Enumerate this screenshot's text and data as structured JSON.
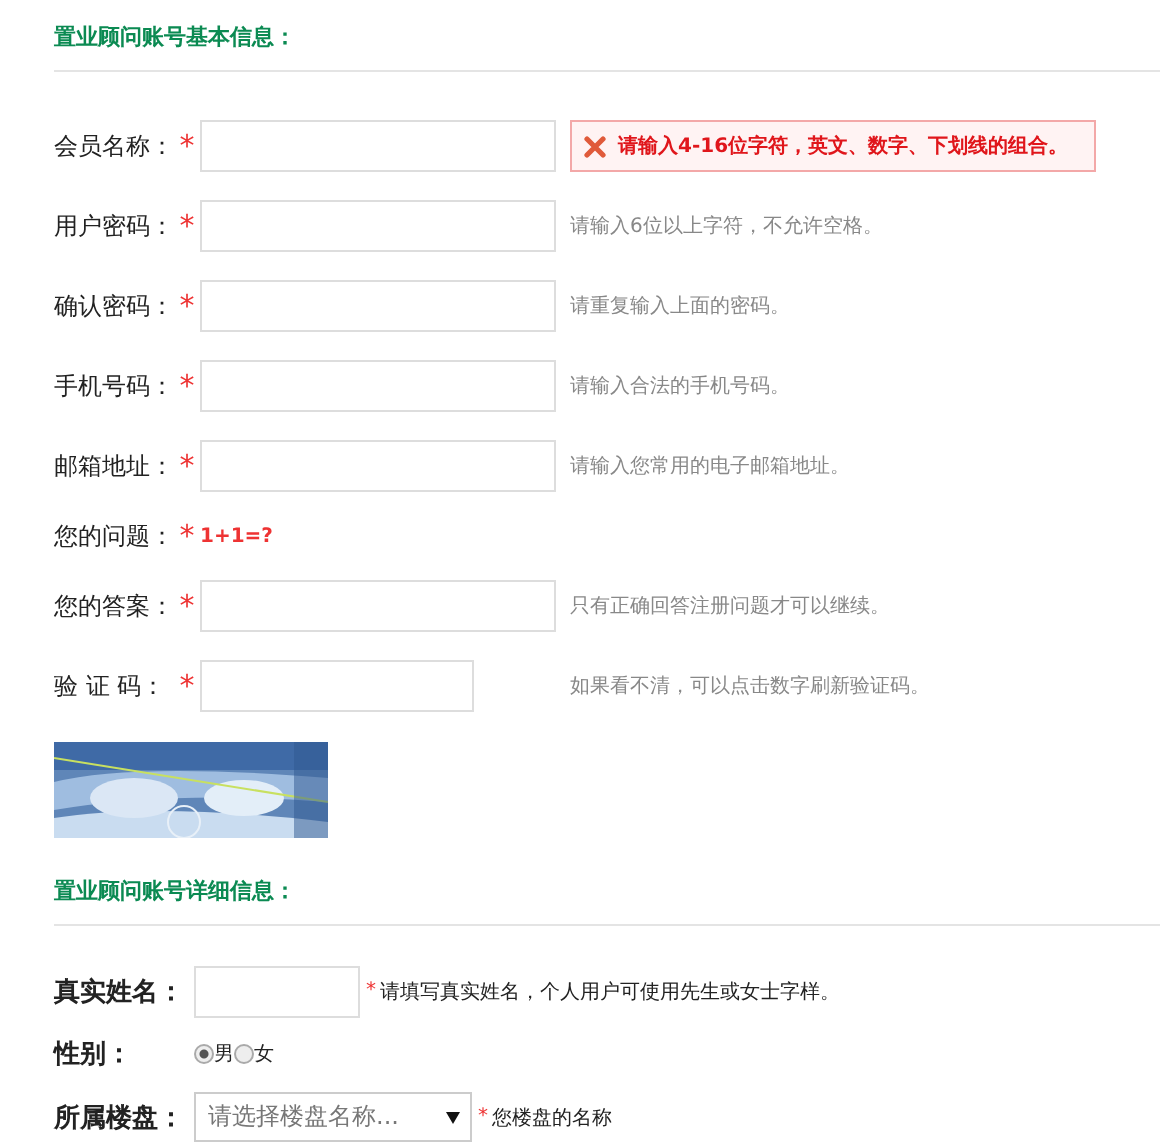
{
  "basic_section": {
    "title": "置业顾问账号基本信息：",
    "fields": [
      {
        "kind": "input",
        "label": "会员名称：",
        "required_mark": "*",
        "message": {
          "kind": "error",
          "text": "请输入4-16位字符，英文、数字、下划线的组合。"
        }
      },
      {
        "kind": "input",
        "label": "用户密码：",
        "required_mark": "*",
        "message": {
          "kind": "hint",
          "text": "请输入6位以上字符，不允许空格。"
        }
      },
      {
        "kind": "input",
        "label": "确认密码：",
        "required_mark": "*",
        "message": {
          "kind": "hint",
          "text": "请重复输入上面的密码。"
        }
      },
      {
        "kind": "input",
        "label": "手机号码：",
        "required_mark": "*",
        "message": {
          "kind": "hint",
          "text": "请输入合法的手机号码。"
        }
      },
      {
        "kind": "input",
        "label": "邮箱地址：",
        "required_mark": "*",
        "message": {
          "kind": "hint",
          "text": "请输入您常用的电子邮箱地址。"
        }
      },
      {
        "kind": "question",
        "label": "您的问题：",
        "required_mark": "*",
        "question": "1+1=?"
      },
      {
        "kind": "input",
        "label": "您的答案：",
        "required_mark": "*",
        "message": {
          "kind": "hint",
          "text": "只有正确回答注册问题才可以继续。"
        }
      },
      {
        "kind": "captcha",
        "label": "验 证 码：",
        "required_mark": "*",
        "message": {
          "kind": "hint",
          "text": "如果看不清，可以点击数字刷新验证码。"
        }
      }
    ]
  },
  "detail_section": {
    "title": "置业顾问账号详细信息：",
    "real_name": {
      "label": "真实姓名：",
      "required_mark": "*",
      "hint": "请填写真实姓名，个人用户可使用先生或女士字样。"
    },
    "gender": {
      "label": "性别：",
      "options": [
        {
          "label": "男",
          "selected": true
        },
        {
          "label": "女",
          "selected": false
        }
      ]
    },
    "building": {
      "label": "所属楼盘：",
      "placeholder": "请选择楼盘名称...",
      "required_mark": "*",
      "hint": "您楼盘的名称"
    }
  }
}
